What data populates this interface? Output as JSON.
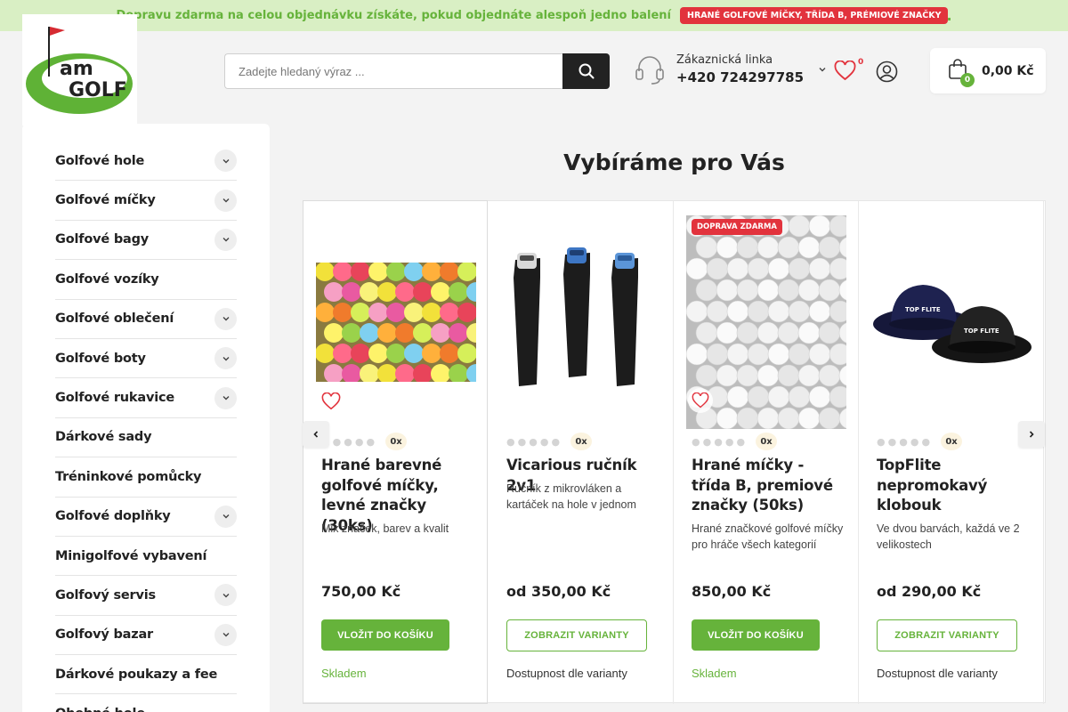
{
  "promo": {
    "text": "Dopravu zdarma na celou objednávku získáte, pokud objednáte alespoň jedno balení",
    "badge": "HRANÉ GOLFOVÉ MÍČKY, TŘÍDA B, PRÉMIOVÉ ZNAČKY",
    "trailing": "."
  },
  "logo": {
    "text_top": "am",
    "text_bottom": "GOLF"
  },
  "search": {
    "placeholder": "Zadejte hledaný výraz ..."
  },
  "hotline": {
    "label": "Zákaznická linka",
    "phone": "+420 724297785"
  },
  "wishlist": {
    "count": "0"
  },
  "cart": {
    "count": "0",
    "total": "0,00 Kč"
  },
  "sidebar": {
    "items": [
      {
        "label": "Golfové hole",
        "expandable": true
      },
      {
        "label": "Golfové míčky",
        "expandable": true
      },
      {
        "label": "Golfové bagy",
        "expandable": true
      },
      {
        "label": "Golfové vozíky",
        "expandable": false
      },
      {
        "label": "Golfové oblečení",
        "expandable": true
      },
      {
        "label": "Golfové boty",
        "expandable": true
      },
      {
        "label": "Golfové rukavice",
        "expandable": true
      },
      {
        "label": "Dárkové sady",
        "expandable": false
      },
      {
        "label": "Tréninkové pomůcky",
        "expandable": false
      },
      {
        "label": "Golfové doplňky",
        "expandable": true
      },
      {
        "label": "Minigolfové vybavení",
        "expandable": false
      },
      {
        "label": "Golfový servis",
        "expandable": true
      },
      {
        "label": "Golfový bazar",
        "expandable": true
      },
      {
        "label": "Dárkové poukazy a fee",
        "expandable": false
      },
      {
        "label": "Ohebné hole ...",
        "expandable": false
      }
    ]
  },
  "main": {
    "title": "Vybíráme pro Vás",
    "products": [
      {
        "title": "Hrané barevné golfové míčky, levné značky (30ks)",
        "desc": "Mix značek, barev a kvalit",
        "price": "750,00 Kč",
        "button": "VLOŽIT DO KOŠÍKU",
        "stock": "Skladem",
        "rating_count": "0x",
        "badge": ""
      },
      {
        "title": "Vicarious ručník 2v1",
        "desc": "Ručník z mikrovláken a kartáček na hole v jednom",
        "price": "od 350,00 Kč",
        "button": "ZOBRAZIT VARIANTY",
        "stock": "Dostupnost dle varianty",
        "rating_count": "0x",
        "badge": ""
      },
      {
        "title": "Hrané míčky - třída B, premiové značky (50ks)",
        "desc": "Hrané značkové golfové míčky pro hráče všech kategorií",
        "price": "850,00 Kč",
        "button": "VLOŽIT DO KOŠÍKU",
        "stock": "Skladem",
        "rating_count": "0x",
        "badge": "DOPRAVA ZDARMA"
      },
      {
        "title": "TopFlite nepromokavý klobouk",
        "desc": "Ve dvou barvách, každá ve 2 velikostech",
        "price": "od 290,00 Kč",
        "button": "ZOBRAZIT VARIANTY",
        "stock": "Dostupnost dle varianty",
        "rating_count": "0x",
        "badge": "",
        "hat_label": "TOP FLITE"
      }
    ]
  },
  "colors": {
    "accent": "#66b33b",
    "badge_red": "#e2333d",
    "promo_bg": "#d9efc4"
  }
}
